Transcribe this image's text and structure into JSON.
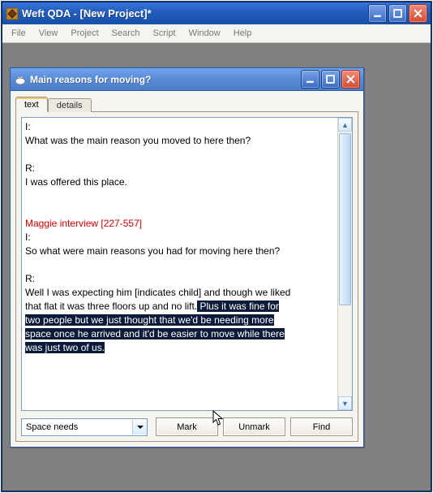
{
  "window": {
    "title": "Weft QDA - [New Project]*"
  },
  "menu": {
    "items": [
      "File",
      "View",
      "Project",
      "Search",
      "Script",
      "Window",
      "Help"
    ]
  },
  "inner_window": {
    "title": "Main reasons for moving?",
    "tabs": {
      "active": "text",
      "inactive": "details"
    },
    "document": {
      "line1": "I:",
      "line2": "What was the main reason you moved to here then?",
      "line3": "R:",
      "line4": "I was offered this place.",
      "heading": "Maggie interview [227-557]",
      "line5": "I:",
      "line6": "So what were main reasons you had for moving here then?",
      "line7": "R:",
      "line8a": "Well I was expecting him [indicates child] and though we liked",
      "line8b": "that flat it was three floors up and no lift.",
      "sel1": " Plus it was fine for ",
      "sel2": "two people but we just thought that we'd be needing more ",
      "sel3": "space once he arrived and it'd be easier to move while there ",
      "sel4": "was just two of us."
    },
    "toolbar": {
      "dropdown_value": "Space needs",
      "mark_label": "Mark",
      "unmark_label": "Unmark",
      "find_label": "Find"
    }
  }
}
